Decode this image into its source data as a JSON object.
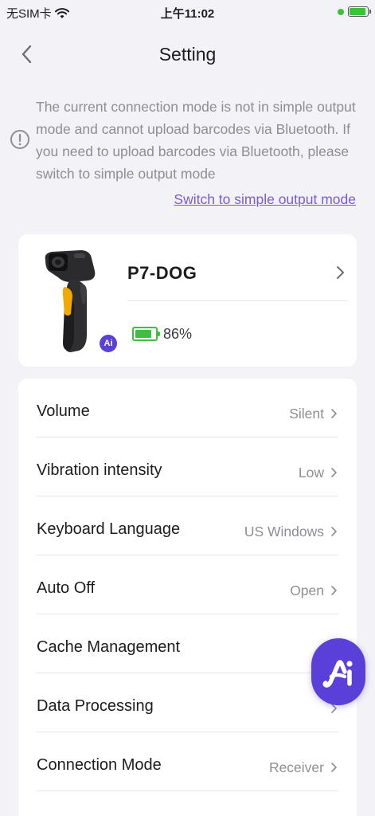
{
  "status_bar": {
    "carrier": "无SIM卡",
    "time": "上午11:02",
    "battery_level": 0.92
  },
  "nav": {
    "title": "Setting",
    "back_icon": "chevron-left-icon"
  },
  "notice": {
    "icon": "info-circle-icon",
    "text": "The current connection mode is not in simple output mode and cannot upload barcodes via Bluetooth. If you need to upload barcodes via Bluetooth, please switch to simple output mode",
    "link_label": "Switch to simple output mode"
  },
  "device": {
    "name": "P7-DOG",
    "battery_text": "86%",
    "battery_level": 0.86,
    "badge_text": "Ai"
  },
  "settings": [
    {
      "label": "Volume",
      "value": "Silent"
    },
    {
      "label": "Vibration intensity",
      "value": "Low"
    },
    {
      "label": "Keyboard Language",
      "value": "US Windows"
    },
    {
      "label": "Auto Off",
      "value": "Open"
    },
    {
      "label": "Cache Management",
      "value": ""
    },
    {
      "label": "Data Processing",
      "value": ""
    },
    {
      "label": "Connection Mode",
      "value": "Receiver"
    },
    {
      "label": "",
      "value": ""
    }
  ],
  "fab": {
    "icon": "ai-assistant-icon"
  },
  "colors": {
    "accent": "#5b3fd9",
    "link": "#7b5cd6",
    "battery_green": "#3cc13b",
    "background": "#f2f2f7"
  }
}
